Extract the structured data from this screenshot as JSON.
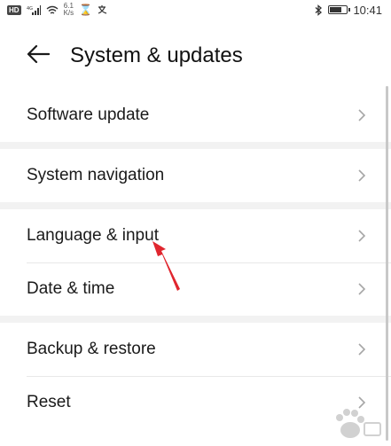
{
  "status_bar": {
    "hd": "HD",
    "net_speed_value": "6.1",
    "net_speed_unit": "K/s",
    "time": "10:41",
    "battery_level": 0.64
  },
  "header": {
    "title": "System & updates"
  },
  "groups": [
    {
      "items": [
        {
          "label": "Software update"
        }
      ]
    },
    {
      "items": [
        {
          "label": "System navigation"
        }
      ]
    },
    {
      "items": [
        {
          "label": "Language & input"
        },
        {
          "label": "Date & time"
        }
      ]
    },
    {
      "items": [
        {
          "label": "Backup & restore"
        },
        {
          "label": "Reset"
        }
      ]
    }
  ],
  "annotation": {
    "color": "#e0262e"
  },
  "watermark": {
    "icon": "baidu-paw-logo"
  }
}
